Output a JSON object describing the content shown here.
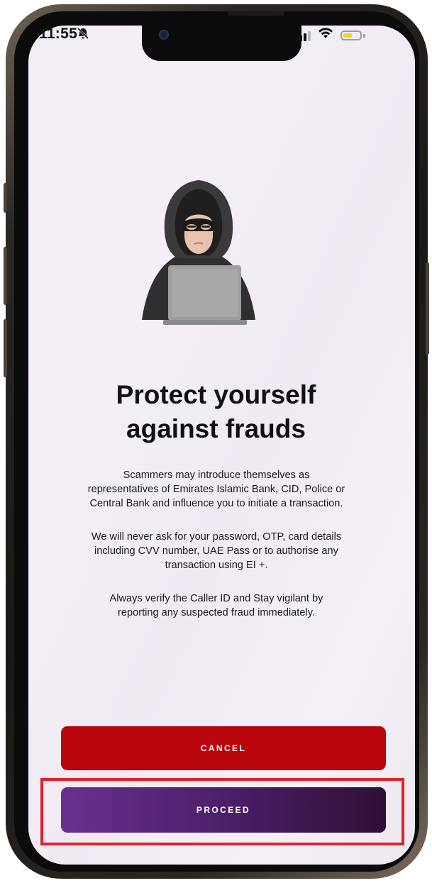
{
  "status_bar": {
    "time": "11:55",
    "mute_icon": "bell-slash-icon",
    "signal_icon": "cellular-signal-icon",
    "wifi_icon": "wifi-icon",
    "battery_icon": "battery-icon"
  },
  "illustration": {
    "icon": "hooded-hacker-with-laptop-icon"
  },
  "heading": {
    "line1": "Protect yourself",
    "line2": "against frauds"
  },
  "body": {
    "p1_l1": "Scammers may introduce themselves as",
    "p1_l2": "representatives of Emirates Islamic Bank, CID, Police or",
    "p1_l3": "Central Bank and influence you to initiate a transaction.",
    "p2_l1": "We will never ask for your password, OTP, card details",
    "p2_l2": "including CVV number, UAE Pass or to authorise any",
    "p2_l3": "transaction using EI +.",
    "p3_l1": "Always verify the Caller ID and Stay vigilant by",
    "p3_l2": "reporting any suspected fraud immediately."
  },
  "actions": {
    "cancel_label": "CANCEL",
    "proceed_label": "PROCEED"
  },
  "colors": {
    "cancel": "#b8060c",
    "proceed_start": "#6a2f8e",
    "proceed_end": "#2d1036",
    "highlight": "#e0212c"
  }
}
